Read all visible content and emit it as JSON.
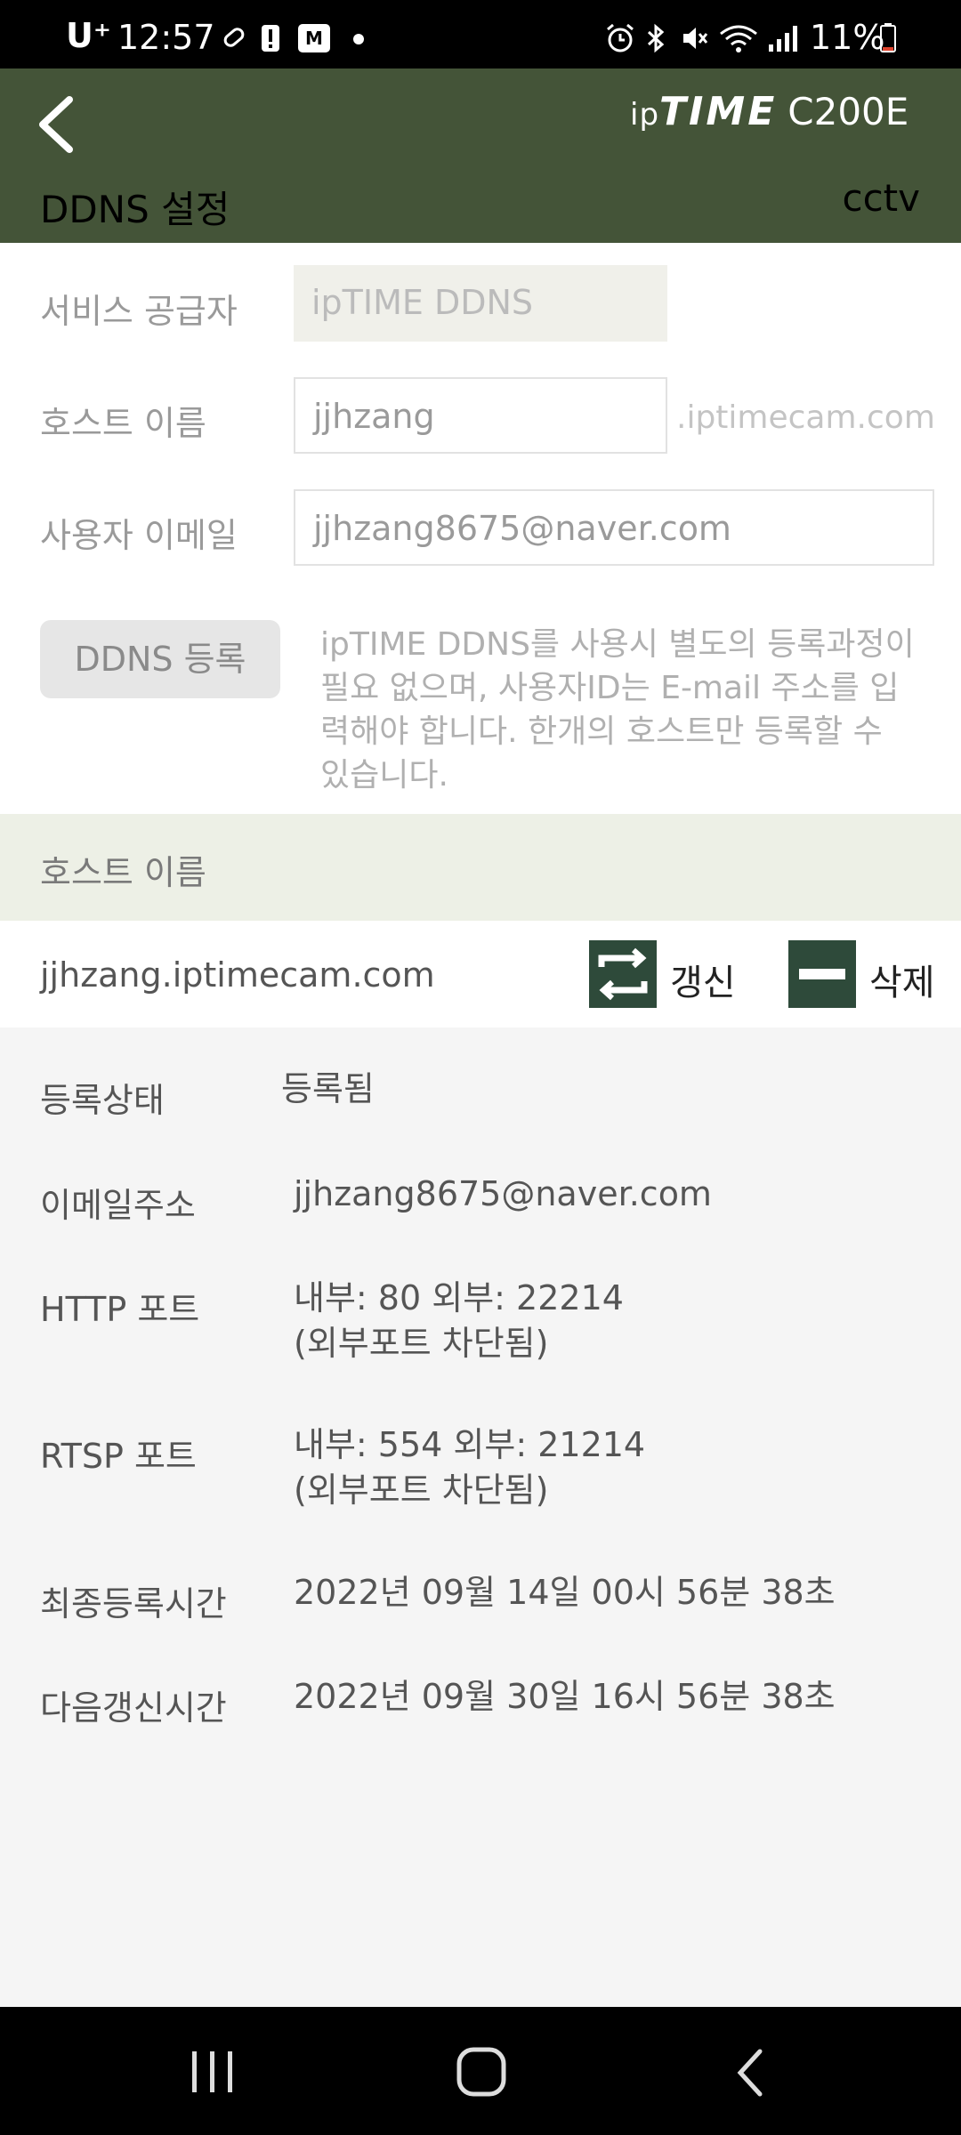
{
  "status_bar": {
    "carrier": "U⁺",
    "time": "12:57",
    "battery_text": "11%"
  },
  "header": {
    "logo_ip": "ip",
    "logo_time": "TIME",
    "model": "C200E",
    "title": "DDNS 설정",
    "device_name": "cctv"
  },
  "form": {
    "provider_label": "서비스 공급자",
    "provider_value": "ipTIME DDNS",
    "host_label": "호스트 이름",
    "host_value": "jjhzang",
    "host_suffix": ".iptimecam.com",
    "email_label": "사용자 이메일",
    "email_value": "jjhzang8675@naver.com",
    "register_button": "DDNS 등록",
    "note": "ipTIME DDNS를 사용시 별도의 등록과정이 필요 없으며, 사용자ID는 E-mail 주소를 입력해야 합니다. 한개의 호스트만 등록할 수 있습니다."
  },
  "host_section": {
    "header": "호스트 이름",
    "hostname": "jjhzang.iptimecam.com",
    "refresh_label": "갱신",
    "delete_label": "삭제"
  },
  "details": {
    "status_label": "등록상태",
    "status_value": "등록됨",
    "email_label": "이메일주소",
    "email_value": "jjhzang8675@naver.com",
    "http_label": "HTTP 포트",
    "http_value": "내부: 80  외부: 22214",
    "http_note": "(외부포트 차단됨)",
    "rtsp_label": "RTSP 포트",
    "rtsp_value": "내부: 554  외부: 21214",
    "rtsp_note": "(외부포트 차단됨)",
    "last_label": "최종등록시간",
    "last_value": "2022년 09월 14일 00시 56분 38초",
    "next_label": "다음갱신시간",
    "next_value": "2022년 09월 30일 16시 56분 38초"
  },
  "colors": {
    "header_bg": "#445438",
    "action_icon_bg": "#2e4a3a",
    "host_header_bg": "#edf0e6"
  }
}
